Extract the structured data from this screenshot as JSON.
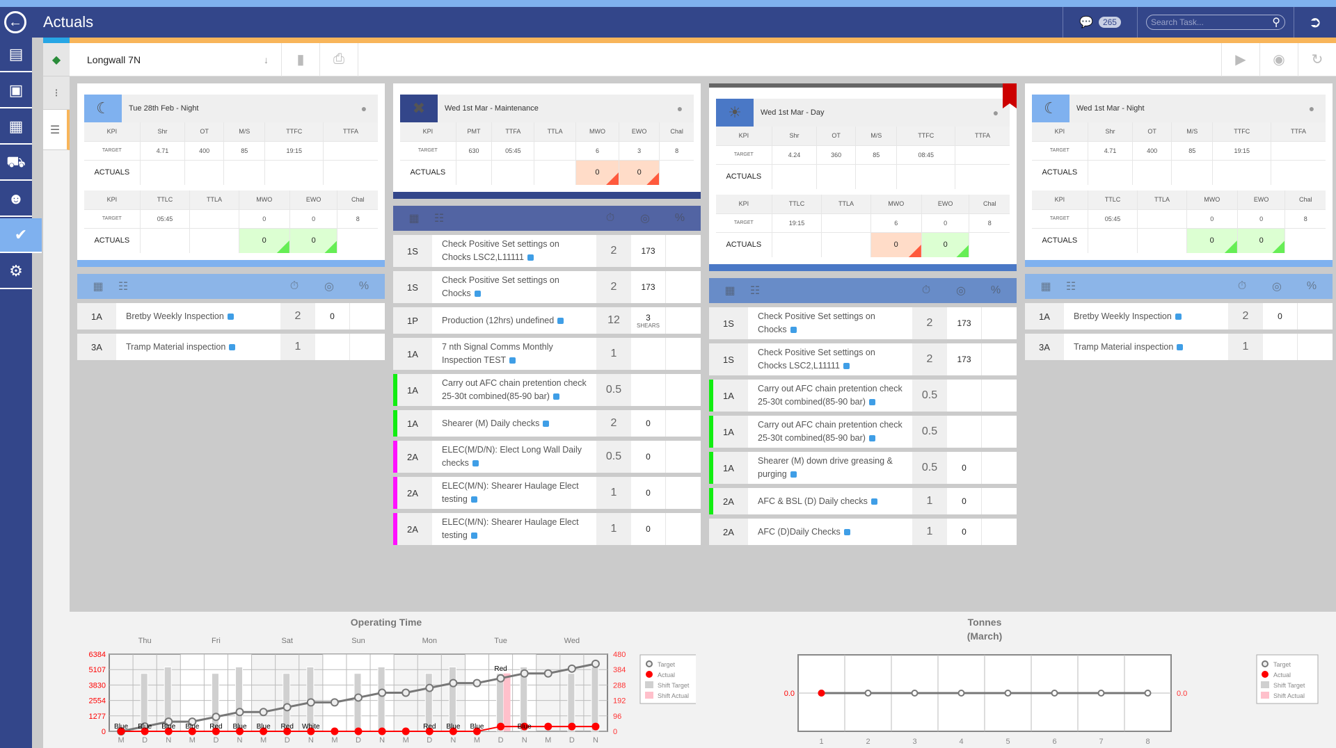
{
  "header": {
    "title": "Actuals",
    "message_count": "265",
    "search_placeholder": "Search Task..."
  },
  "sidebar": {
    "items": [
      {
        "name": "reports",
        "icon": "bar-chart-icon"
      },
      {
        "name": "pinboard",
        "icon": "pin-board-icon"
      },
      {
        "name": "schedule",
        "icon": "gantt-icon"
      },
      {
        "name": "equipment",
        "icon": "dump-truck-icon"
      },
      {
        "name": "people",
        "icon": "users-icon"
      },
      {
        "name": "actuals",
        "icon": "check-circle-icon",
        "active": true
      },
      {
        "name": "settings",
        "icon": "documents-gear-icon"
      }
    ]
  },
  "subnav": {
    "items": [
      "logo",
      "workflow",
      "list"
    ]
  },
  "toolbar": {
    "location": "Longwall 7N"
  },
  "colors": {
    "accent_blue": "#33468a",
    "light_blue": "#7fb1ef",
    "orange": "#f8b55a",
    "good": "#66ee55",
    "bad": "#ff5a3d"
  },
  "shifts": [
    {
      "title": "Tue 28th Feb - Night",
      "icon": "moon-icon",
      "icon_bg": "#7fb1ef",
      "bar": "#7fb1ef",
      "list_head": "#8cb5e8",
      "kpi1": {
        "headers": [
          "KPI",
          "Shr",
          "OT",
          "M/S",
          "TTFC",
          "TTFA"
        ],
        "target": [
          "TARGET",
          "4.71",
          "400",
          "85",
          "19:15",
          ""
        ],
        "actual": [
          "ACTUALS",
          "",
          "",
          "",
          "",
          ""
        ]
      },
      "kpi2": {
        "headers": [
          "KPI",
          "TTLC",
          "TTLA",
          "MWO",
          "EWO",
          "Chal"
        ],
        "target": [
          "TARGET",
          "05:45",
          "",
          "0",
          "0",
          "8"
        ],
        "actual": [
          "ACTUALS",
          "",
          "",
          "0",
          "0",
          ""
        ],
        "status": [
          "",
          "",
          "",
          "good",
          "good",
          ""
        ]
      },
      "tasks": [
        {
          "code": "1A",
          "desc": "Bretby Weekly Inspection",
          "num": "2",
          "val": "0"
        },
        {
          "code": "3A",
          "desc": "Tramp Material inspection",
          "num": "1",
          "val": ""
        }
      ]
    },
    {
      "title": "Wed 1st Mar - Maintenance",
      "icon": "tools-icon",
      "icon_bg": "#33468a",
      "bar": "#33468a",
      "list_head": "#5264a3",
      "kpi1": {
        "headers": [
          "KPI",
          "PMT",
          "TTFA",
          "TTLA",
          "MWO",
          "EWO",
          "Chal"
        ],
        "target": [
          "TARGET",
          "630",
          "05:45",
          "",
          "6",
          "3",
          "8"
        ],
        "actual": [
          "ACTUALS",
          "",
          "",
          "",
          "0",
          "0",
          ""
        ],
        "status": [
          "",
          "",
          "",
          "",
          "bad",
          "bad",
          ""
        ]
      },
      "tasks": [
        {
          "code": "1S",
          "desc": "Check Positive Set settings on Chocks LSC2,L11111",
          "num": "2",
          "val": "173"
        },
        {
          "code": "1S",
          "desc": "Check Positive Set settings on Chocks",
          "num": "2",
          "val": "173"
        },
        {
          "code": "1P",
          "desc": "Production (12hrs) undefined",
          "num": "12",
          "val": "3",
          "sub": "SHEARS"
        },
        {
          "code": "1A",
          "desc": "7 nth Signal Comms Monthly Inspection TEST",
          "num": "1",
          "val": ""
        },
        {
          "code": "1A",
          "desc": "Carry out AFC chain pretention check 25-30t combined(85-90 bar)",
          "num": "0.5",
          "val": "",
          "mark": "green"
        },
        {
          "code": "1A",
          "desc": "Shearer (M) Daily checks",
          "num": "2",
          "val": "0",
          "mark": "green"
        },
        {
          "code": "2A",
          "desc": "ELEC(M/D/N): Elect Long Wall Daily checks",
          "num": "0.5",
          "val": "0",
          "mark": "magenta"
        },
        {
          "code": "2A",
          "desc": "ELEC(M/N): Shearer Haulage Elect testing",
          "num": "1",
          "val": "0",
          "mark": "magenta"
        },
        {
          "code": "2A",
          "desc": "ELEC(M/N): Shearer Haulage Elect testing",
          "num": "1",
          "val": "0",
          "mark": "magenta"
        }
      ]
    },
    {
      "title": "Wed 1st Mar - Day",
      "icon": "sun-icon",
      "icon_bg": "#4a78c6",
      "bar": "#4a78c6",
      "list_head": "#688cc8",
      "flagged": true,
      "kpi1": {
        "headers": [
          "KPI",
          "Shr",
          "OT",
          "M/S",
          "TTFC",
          "TTFA"
        ],
        "target": [
          "TARGET",
          "4.24",
          "360",
          "85",
          "08:45",
          ""
        ],
        "actual": [
          "ACTUALS",
          "",
          "",
          "",
          "",
          ""
        ]
      },
      "kpi2": {
        "headers": [
          "KPI",
          "TTLC",
          "TTLA",
          "MWO",
          "EWO",
          "Chal"
        ],
        "target": [
          "TARGET",
          "19:15",
          "",
          "6",
          "0",
          "8"
        ],
        "actual": [
          "ACTUALS",
          "",
          "",
          "0",
          "0",
          ""
        ],
        "status": [
          "",
          "",
          "",
          "bad",
          "good",
          ""
        ]
      },
      "tasks": [
        {
          "code": "1S",
          "desc": "Check Positive Set settings on Chocks",
          "num": "2",
          "val": "173"
        },
        {
          "code": "1S",
          "desc": "Check Positive Set settings on Chocks LSC2,L11111",
          "num": "2",
          "val": "173"
        },
        {
          "code": "1A",
          "desc": "Carry out AFC chain pretention check 25-30t combined(85-90 bar)",
          "num": "0.5",
          "val": "",
          "mark": "green"
        },
        {
          "code": "1A",
          "desc": "Carry out AFC chain pretention check 25-30t combined(85-90 bar)",
          "num": "0.5",
          "val": "",
          "mark": "green"
        },
        {
          "code": "1A",
          "desc": "Shearer (M) down drive greasing & purging",
          "num": "0.5",
          "val": "0",
          "mark": "green"
        },
        {
          "code": "2A",
          "desc": "AFC & BSL (D) Daily checks",
          "num": "1",
          "val": "0",
          "mark": "green"
        },
        {
          "code": "2A",
          "desc": "AFC (D)Daily Checks",
          "num": "1",
          "val": "0"
        }
      ]
    },
    {
      "title": "Wed 1st Mar - Night",
      "icon": "moon-icon",
      "icon_bg": "#7fb1ef",
      "bar": "#7fb1ef",
      "list_head": "#8cb5e8",
      "kpi1": {
        "headers": [
          "KPI",
          "Shr",
          "OT",
          "M/S",
          "TTFC",
          "TTFA"
        ],
        "target": [
          "TARGET",
          "4.71",
          "400",
          "85",
          "19:15",
          ""
        ],
        "actual": [
          "ACTUALS",
          "",
          "",
          "",
          "",
          ""
        ]
      },
      "kpi2": {
        "headers": [
          "KPI",
          "TTLC",
          "TTLA",
          "MWO",
          "EWO",
          "Chal"
        ],
        "target": [
          "TARGET",
          "05:45",
          "",
          "0",
          "0",
          "8"
        ],
        "actual": [
          "ACTUALS",
          "",
          "",
          "0",
          "0",
          ""
        ],
        "status": [
          "",
          "",
          "",
          "good",
          "good",
          ""
        ]
      },
      "tasks": [
        {
          "code": "1A",
          "desc": "Bretby Weekly Inspection",
          "num": "2",
          "val": "0"
        },
        {
          "code": "3A",
          "desc": "Tramp Material inspection",
          "num": "1",
          "val": ""
        }
      ]
    }
  ],
  "chart_data": [
    {
      "type": "line",
      "title": "Operating Time",
      "days": [
        "Thu",
        "Fri",
        "Sat",
        "Sun",
        "Mon",
        "Tue",
        "Wed"
      ],
      "x": [
        "M",
        "D",
        "N",
        "M",
        "D",
        "N",
        "M",
        "D",
        "N",
        "M",
        "D",
        "N",
        "M",
        "D",
        "N",
        "M",
        "D",
        "N",
        "M",
        "D",
        "N"
      ],
      "y_left_ticks": [
        "0",
        "1277",
        "2554",
        "3830",
        "5107",
        "6384"
      ],
      "y_right_ticks": [
        "0",
        "96",
        "192",
        "288",
        "384",
        "480"
      ],
      "ylim_right": [
        0,
        480
      ],
      "series": [
        {
          "name": "Target",
          "values": [
            0,
            30,
            60,
            60,
            90,
            120,
            120,
            150,
            180,
            180,
            210,
            240,
            240,
            270,
            300,
            300,
            330,
            360,
            360,
            390,
            420
          ]
        },
        {
          "name": "Actual",
          "values": [
            0,
            0,
            0,
            0,
            0,
            0,
            0,
            0,
            0,
            0,
            0,
            0,
            0,
            0,
            0,
            0,
            30,
            30,
            30,
            30,
            30
          ]
        },
        {
          "name": "Shift Target",
          "values": [
            null,
            360,
            400,
            null,
            360,
            400,
            null,
            360,
            400,
            null,
            360,
            400,
            null,
            360,
            400,
            null,
            360,
            400,
            null,
            360,
            400
          ]
        },
        {
          "name": "Shift Actual",
          "values": [
            null,
            null,
            null,
            null,
            null,
            null,
            null,
            null,
            null,
            null,
            null,
            null,
            null,
            null,
            null,
            null,
            360,
            null,
            null,
            null,
            null
          ]
        }
      ],
      "point_labels": [
        "Blue",
        "Blue",
        "Blue",
        "Blue",
        "Red",
        "Blue",
        "Blue",
        "Red",
        "White",
        "",
        "",
        "",
        "",
        "Red",
        "Blue",
        "Blue",
        "Red",
        "Blue",
        "",
        "",
        ""
      ],
      "legend": [
        "Target",
        "Actual",
        "Shift Target",
        "Shift Actual"
      ],
      "legend_position": "right"
    },
    {
      "type": "line",
      "title": "Tonnes",
      "subtitle": "(March)",
      "x": [
        "1",
        "2",
        "3",
        "4",
        "5",
        "6",
        "7",
        "8"
      ],
      "y_ticks": [
        "0.0"
      ],
      "series": [
        {
          "name": "Target",
          "values": [
            0,
            0,
            0,
            0,
            0,
            0,
            0,
            0
          ]
        },
        {
          "name": "Actual",
          "values": [
            0
          ]
        }
      ],
      "legend": [
        "Target",
        "Actual",
        "Shift Target",
        "Shift Actual"
      ],
      "legend_position": "right"
    }
  ]
}
